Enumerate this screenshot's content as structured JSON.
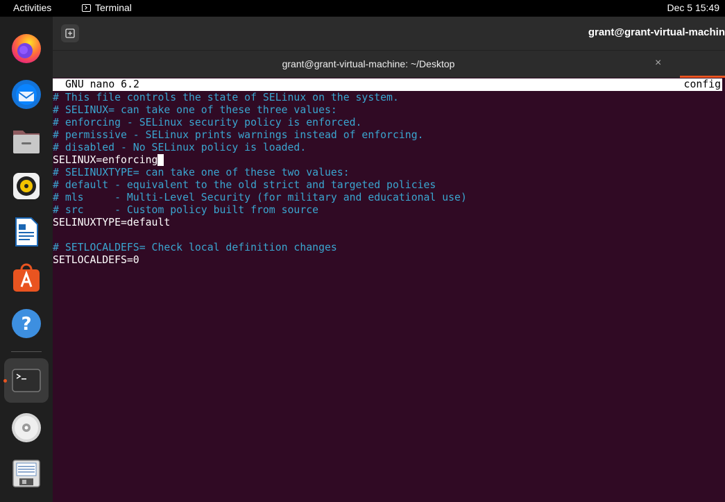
{
  "topbar": {
    "activities": "Activities",
    "app_name": "Terminal",
    "clock": "Dec 5  15:49"
  },
  "dock": {
    "items": [
      "firefox-icon",
      "thunderbird-icon",
      "files-icon",
      "rhythmbox-icon",
      "libreoffice-writer-icon",
      "app-center-icon",
      "help-icon",
      "terminal-icon",
      "dvd-icon",
      "save-disk-icon"
    ]
  },
  "window": {
    "header_title": "grant@grant-virtual-machin",
    "tab_title": "grant@grant-virtual-machine: ~/Desktop",
    "tab_close": "×"
  },
  "nano": {
    "version": "GNU nano 6.2",
    "filename": "config"
  },
  "file_lines": [
    {
      "text": "# This file controls the state of SELinux on the system.",
      "type": "comment"
    },
    {
      "text": "# SELINUX= can take one of these three values:",
      "type": "comment"
    },
    {
      "text": "# enforcing - SELinux security policy is enforced.",
      "type": "comment"
    },
    {
      "text": "# permissive - SELinux prints warnings instead of enforcing.",
      "type": "comment"
    },
    {
      "text": "# disabled - No SELinux policy is loaded.",
      "type": "comment"
    },
    {
      "text": "SELINUX=enforcing",
      "type": "setting"
    },
    {
      "text": "# SELINUXTYPE= can take one of these two values:",
      "type": "comment"
    },
    {
      "text": "# default - equivalent to the old strict and targeted policies",
      "type": "comment"
    },
    {
      "text": "# mls     - Multi-Level Security (for military and educational use)",
      "type": "comment"
    },
    {
      "text": "# src     - Custom policy built from source",
      "type": "comment"
    },
    {
      "text": "SELINUXTYPE=default",
      "type": "setting"
    },
    {
      "text": "",
      "type": "setting"
    },
    {
      "text": "# SETLOCALDEFS= Check local definition changes",
      "type": "comment"
    },
    {
      "text": "SETLOCALDEFS=0",
      "type": "setting"
    }
  ],
  "colors": {
    "terminal_bg": "#300a24",
    "comment": "#3aa6d0",
    "accent": "#e95420"
  }
}
